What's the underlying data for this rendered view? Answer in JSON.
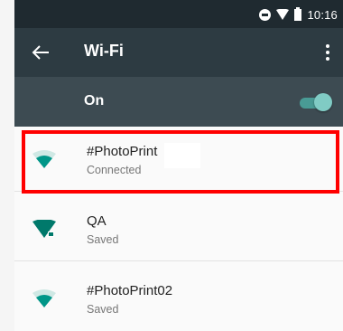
{
  "status_bar": {
    "time": "10:16",
    "icons": [
      "do-not-disturb-icon",
      "wifi-signal-icon",
      "battery-icon"
    ]
  },
  "toolbar": {
    "title": "Wi-Fi",
    "back_icon": "arrow-back-icon",
    "menu_icon": "more-vert-icon"
  },
  "master_switch": {
    "label": "On",
    "enabled": true
  },
  "networks": [
    {
      "name": "#PhotoPrint",
      "status": "Connected",
      "icon": "wifi-signal-icon",
      "secured": false
    },
    {
      "name": "QA",
      "status": "Saved",
      "icon": "wifi-lock-icon",
      "secured": true
    },
    {
      "name": "#PhotoPrint02",
      "status": "Saved",
      "icon": "wifi-signal-icon",
      "secured": false
    }
  ],
  "colors": {
    "status_bar_bg": "#1f2a30",
    "toolbar_bg": "#2d3b42",
    "switch_bar_bg": "#3d4b52",
    "accent": "#009688",
    "highlight": "#ff0000"
  }
}
